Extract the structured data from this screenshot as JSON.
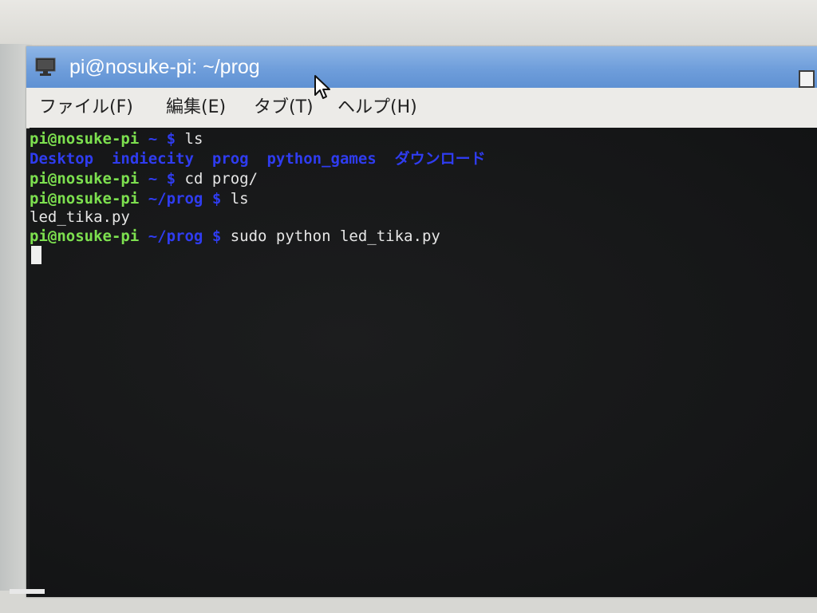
{
  "window": {
    "title": "pi@nosuke-pi: ~/prog",
    "icon": "monitor-icon"
  },
  "menu": {
    "items": [
      "ファイル(F)",
      "編集(E)",
      "タブ(T)",
      "ヘルプ(H)"
    ]
  },
  "terminal": {
    "prompt_user": "pi@nosuke-pi",
    "lines": [
      {
        "type": "prompt",
        "path": "~",
        "symbol": "$",
        "command": " ls"
      },
      {
        "type": "ls_output",
        "items": [
          "Desktop",
          "indiecity",
          "prog",
          "python_games",
          "ダウンロード"
        ]
      },
      {
        "type": "prompt",
        "path": "~",
        "symbol": "$",
        "command": " cd prog/"
      },
      {
        "type": "prompt",
        "path": "~/prog",
        "symbol": "$",
        "command": " ls"
      },
      {
        "type": "output",
        "text": "led_tika.py"
      },
      {
        "type": "prompt",
        "path": "~/prog",
        "symbol": "$",
        "command": " sudo python led_tika.py"
      }
    ]
  },
  "colors": {
    "prompt_user": "#7de04f",
    "directory": "#2f3cf0",
    "text": "#e6e6e6",
    "titlebar": "#6f9edb"
  }
}
